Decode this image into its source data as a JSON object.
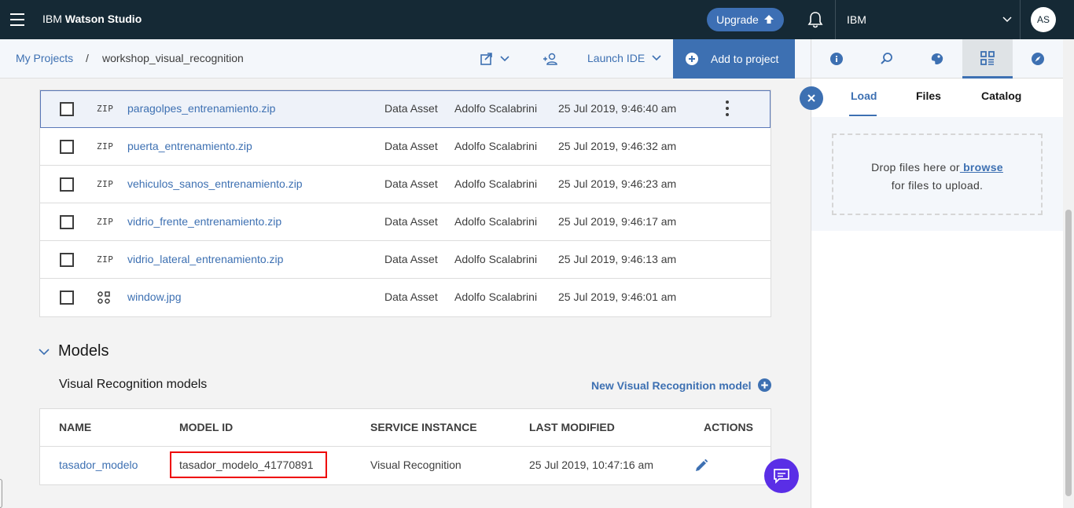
{
  "topbar": {
    "brand_prefix": "IBM",
    "brand_name": "Watson Studio",
    "upgrade_label": "Upgrade",
    "account_name": "IBM",
    "avatar_initials": "AS"
  },
  "subbar": {
    "breadcrumb_root": "My Projects",
    "breadcrumb_sep": "/",
    "breadcrumb_current": "workshop_visual_recognition",
    "launch_ide_label": "Launch IDE",
    "add_to_project_label": "Add to project"
  },
  "assets": [
    {
      "icon": "ZIP",
      "name": "paragolpes_entrenamiento.zip",
      "type": "Data Asset",
      "owner": "Adolfo Scalabrini",
      "date": "25 Jul 2019, 9:46:40 am"
    },
    {
      "icon": "ZIP",
      "name": "puerta_entrenamiento.zip",
      "type": "Data Asset",
      "owner": "Adolfo Scalabrini",
      "date": "25 Jul 2019, 9:46:32 am"
    },
    {
      "icon": "ZIP",
      "name": "vehiculos_sanos_entrenamiento.zip",
      "type": "Data Asset",
      "owner": "Adolfo Scalabrini",
      "date": "25 Jul 2019, 9:46:23 am"
    },
    {
      "icon": "ZIP",
      "name": "vidrio_frente_entrenamiento.zip",
      "type": "Data Asset",
      "owner": "Adolfo Scalabrini",
      "date": "25 Jul 2019, 9:46:17 am"
    },
    {
      "icon": "ZIP",
      "name": "vidrio_lateral_entrenamiento.zip",
      "type": "Data Asset",
      "owner": "Adolfo Scalabrini",
      "date": "25 Jul 2019, 9:46:13 am"
    },
    {
      "icon": "image-icon",
      "name": "window.jpg",
      "type": "Data Asset",
      "owner": "Adolfo Scalabrini",
      "date": "25 Jul 2019, 9:46:01 am"
    }
  ],
  "models": {
    "section_title": "Models",
    "subsection_title": "Visual Recognition models",
    "new_model_label": "New Visual Recognition model",
    "columns": [
      "NAME",
      "MODEL ID",
      "SERVICE INSTANCE",
      "LAST MODIFIED",
      "ACTIONS"
    ],
    "rows": [
      {
        "name": "tasador_modelo",
        "model_id": "tasador_modelo_41770891",
        "service": "Visual Recognition",
        "modified": "25 Jul 2019, 10:47:16 am"
      }
    ]
  },
  "panel": {
    "tabs": [
      "Load",
      "Files",
      "Catalog"
    ],
    "active_tab": "Load",
    "drop_text_1": "Drop files here or",
    "browse_label": " browse",
    "drop_text_2": "for files to upload."
  },
  "colors": {
    "topbar": "#152935",
    "accent": "#3d70b2",
    "upgrade": "#3d6fb4",
    "chat": "#5a2ee6",
    "highlight": "#ee0000"
  }
}
